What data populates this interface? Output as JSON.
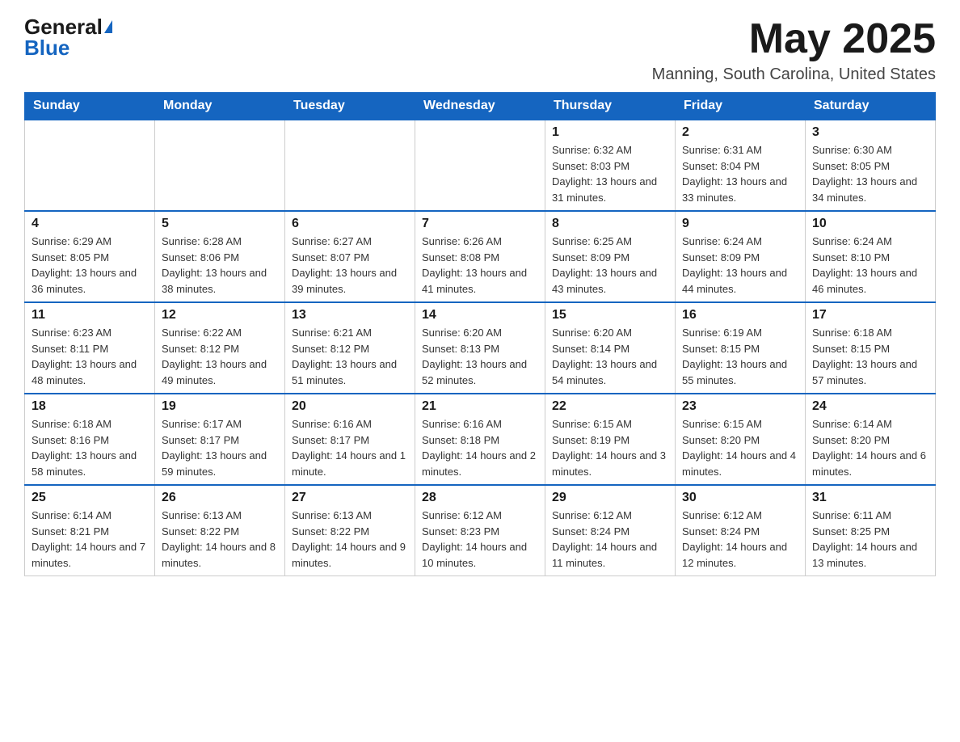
{
  "logo": {
    "general": "General",
    "blue": "Blue"
  },
  "title": {
    "month": "May 2025",
    "location": "Manning, South Carolina, United States"
  },
  "days_of_week": [
    "Sunday",
    "Monday",
    "Tuesday",
    "Wednesday",
    "Thursday",
    "Friday",
    "Saturday"
  ],
  "weeks": [
    [
      {
        "day": "",
        "info": ""
      },
      {
        "day": "",
        "info": ""
      },
      {
        "day": "",
        "info": ""
      },
      {
        "day": "",
        "info": ""
      },
      {
        "day": "1",
        "info": "Sunrise: 6:32 AM\nSunset: 8:03 PM\nDaylight: 13 hours and 31 minutes."
      },
      {
        "day": "2",
        "info": "Sunrise: 6:31 AM\nSunset: 8:04 PM\nDaylight: 13 hours and 33 minutes."
      },
      {
        "day": "3",
        "info": "Sunrise: 6:30 AM\nSunset: 8:05 PM\nDaylight: 13 hours and 34 minutes."
      }
    ],
    [
      {
        "day": "4",
        "info": "Sunrise: 6:29 AM\nSunset: 8:05 PM\nDaylight: 13 hours and 36 minutes."
      },
      {
        "day": "5",
        "info": "Sunrise: 6:28 AM\nSunset: 8:06 PM\nDaylight: 13 hours and 38 minutes."
      },
      {
        "day": "6",
        "info": "Sunrise: 6:27 AM\nSunset: 8:07 PM\nDaylight: 13 hours and 39 minutes."
      },
      {
        "day": "7",
        "info": "Sunrise: 6:26 AM\nSunset: 8:08 PM\nDaylight: 13 hours and 41 minutes."
      },
      {
        "day": "8",
        "info": "Sunrise: 6:25 AM\nSunset: 8:09 PM\nDaylight: 13 hours and 43 minutes."
      },
      {
        "day": "9",
        "info": "Sunrise: 6:24 AM\nSunset: 8:09 PM\nDaylight: 13 hours and 44 minutes."
      },
      {
        "day": "10",
        "info": "Sunrise: 6:24 AM\nSunset: 8:10 PM\nDaylight: 13 hours and 46 minutes."
      }
    ],
    [
      {
        "day": "11",
        "info": "Sunrise: 6:23 AM\nSunset: 8:11 PM\nDaylight: 13 hours and 48 minutes."
      },
      {
        "day": "12",
        "info": "Sunrise: 6:22 AM\nSunset: 8:12 PM\nDaylight: 13 hours and 49 minutes."
      },
      {
        "day": "13",
        "info": "Sunrise: 6:21 AM\nSunset: 8:12 PM\nDaylight: 13 hours and 51 minutes."
      },
      {
        "day": "14",
        "info": "Sunrise: 6:20 AM\nSunset: 8:13 PM\nDaylight: 13 hours and 52 minutes."
      },
      {
        "day": "15",
        "info": "Sunrise: 6:20 AM\nSunset: 8:14 PM\nDaylight: 13 hours and 54 minutes."
      },
      {
        "day": "16",
        "info": "Sunrise: 6:19 AM\nSunset: 8:15 PM\nDaylight: 13 hours and 55 minutes."
      },
      {
        "day": "17",
        "info": "Sunrise: 6:18 AM\nSunset: 8:15 PM\nDaylight: 13 hours and 57 minutes."
      }
    ],
    [
      {
        "day": "18",
        "info": "Sunrise: 6:18 AM\nSunset: 8:16 PM\nDaylight: 13 hours and 58 minutes."
      },
      {
        "day": "19",
        "info": "Sunrise: 6:17 AM\nSunset: 8:17 PM\nDaylight: 13 hours and 59 minutes."
      },
      {
        "day": "20",
        "info": "Sunrise: 6:16 AM\nSunset: 8:17 PM\nDaylight: 14 hours and 1 minute."
      },
      {
        "day": "21",
        "info": "Sunrise: 6:16 AM\nSunset: 8:18 PM\nDaylight: 14 hours and 2 minutes."
      },
      {
        "day": "22",
        "info": "Sunrise: 6:15 AM\nSunset: 8:19 PM\nDaylight: 14 hours and 3 minutes."
      },
      {
        "day": "23",
        "info": "Sunrise: 6:15 AM\nSunset: 8:20 PM\nDaylight: 14 hours and 4 minutes."
      },
      {
        "day": "24",
        "info": "Sunrise: 6:14 AM\nSunset: 8:20 PM\nDaylight: 14 hours and 6 minutes."
      }
    ],
    [
      {
        "day": "25",
        "info": "Sunrise: 6:14 AM\nSunset: 8:21 PM\nDaylight: 14 hours and 7 minutes."
      },
      {
        "day": "26",
        "info": "Sunrise: 6:13 AM\nSunset: 8:22 PM\nDaylight: 14 hours and 8 minutes."
      },
      {
        "day": "27",
        "info": "Sunrise: 6:13 AM\nSunset: 8:22 PM\nDaylight: 14 hours and 9 minutes."
      },
      {
        "day": "28",
        "info": "Sunrise: 6:12 AM\nSunset: 8:23 PM\nDaylight: 14 hours and 10 minutes."
      },
      {
        "day": "29",
        "info": "Sunrise: 6:12 AM\nSunset: 8:24 PM\nDaylight: 14 hours and 11 minutes."
      },
      {
        "day": "30",
        "info": "Sunrise: 6:12 AM\nSunset: 8:24 PM\nDaylight: 14 hours and 12 minutes."
      },
      {
        "day": "31",
        "info": "Sunrise: 6:11 AM\nSunset: 8:25 PM\nDaylight: 14 hours and 13 minutes."
      }
    ]
  ]
}
